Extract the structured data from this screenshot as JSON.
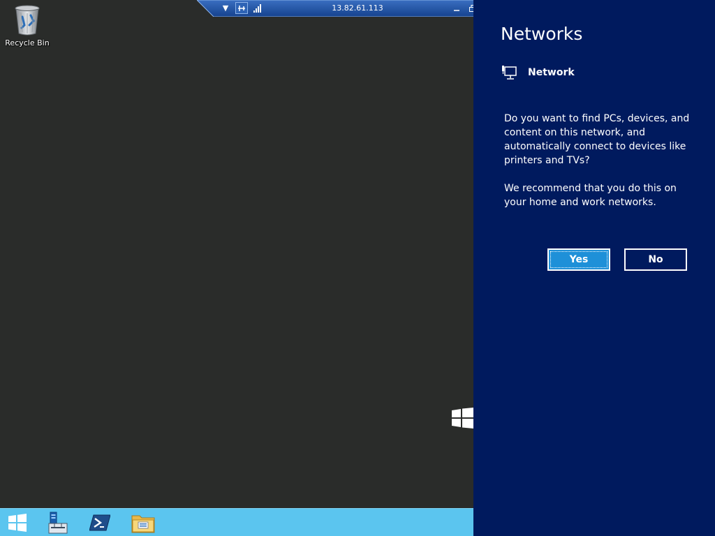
{
  "desktop": {
    "icons": [
      {
        "label": "Recycle Bin",
        "icon": "recycle-bin-icon"
      }
    ]
  },
  "rdp_bar": {
    "host": "13.82.61.113",
    "icons": [
      "dropdown-arrow-icon",
      "pin-icon",
      "signal-strength-icon",
      "minimize-icon",
      "restore-icon",
      "close-icon"
    ]
  },
  "taskbar": {
    "items": [
      {
        "icon": "start-windows-icon"
      },
      {
        "icon": "server-manager-icon"
      },
      {
        "icon": "powershell-icon"
      },
      {
        "icon": "file-explorer-icon"
      }
    ]
  },
  "networks_panel": {
    "title": "Networks",
    "network_name": "Network",
    "message_1": "Do you want to find PCs, devices, and content on this network, and automatically connect to devices like printers and TVs?",
    "message_2": "We recommend that you do this on your home and work networks.",
    "yes_label": "Yes",
    "no_label": "No"
  },
  "colors": {
    "desktop_bg": "#2a2c2a",
    "panel_bg": "#001a5e",
    "taskbar_bg": "#5bc5ef",
    "yes_button": "#1e90d8"
  }
}
